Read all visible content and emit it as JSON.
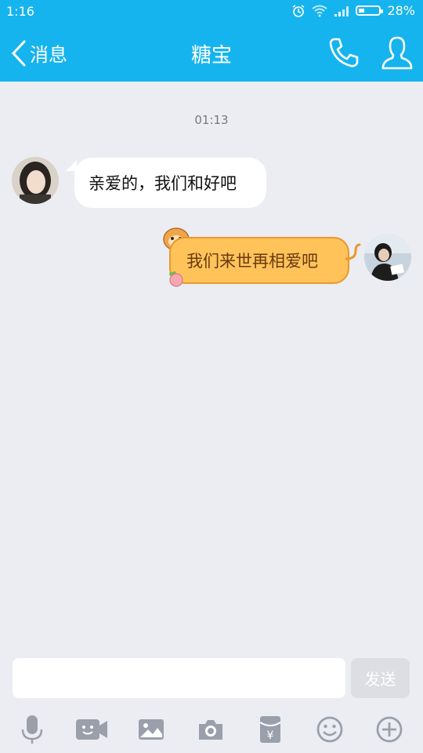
{
  "status_bar": {
    "time": "1:16",
    "battery": "28%"
  },
  "nav": {
    "back_label": "消息",
    "title": "糖宝"
  },
  "chat": {
    "timestamp": "01:13",
    "messages": [
      {
        "side": "left",
        "text": "亲爱的，我们和好吧"
      },
      {
        "side": "right",
        "text": "我们来世再相爱吧"
      }
    ]
  },
  "composer": {
    "input_value": "",
    "send_label": "发送"
  },
  "toolbar": {
    "icons": [
      "mic-icon",
      "video-icon",
      "image-icon",
      "camera-icon",
      "red-packet-icon",
      "emoji-icon",
      "plus-icon"
    ]
  },
  "colors": {
    "accent": "#16b4ee",
    "background": "#ebedf2",
    "bubble_right": "#ffc35a"
  }
}
